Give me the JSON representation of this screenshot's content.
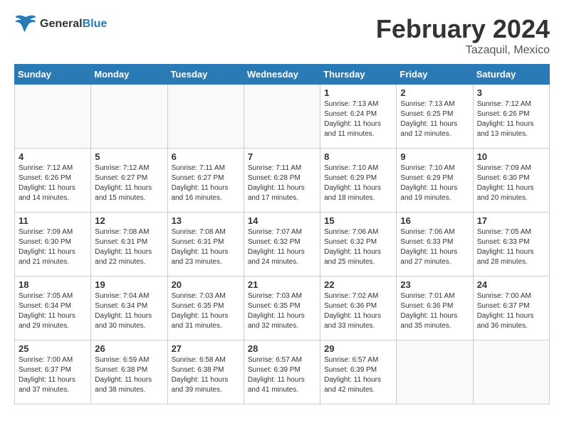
{
  "header": {
    "logo_line1": "General",
    "logo_line2": "Blue",
    "month_title": "February 2024",
    "location": "Tazaquil, Mexico"
  },
  "weekdays": [
    "Sunday",
    "Monday",
    "Tuesday",
    "Wednesday",
    "Thursday",
    "Friday",
    "Saturday"
  ],
  "weeks": [
    [
      {
        "day": "",
        "info": ""
      },
      {
        "day": "",
        "info": ""
      },
      {
        "day": "",
        "info": ""
      },
      {
        "day": "",
        "info": ""
      },
      {
        "day": "1",
        "info": "Sunrise: 7:13 AM\nSunset: 6:24 PM\nDaylight: 11 hours\nand 11 minutes."
      },
      {
        "day": "2",
        "info": "Sunrise: 7:13 AM\nSunset: 6:25 PM\nDaylight: 11 hours\nand 12 minutes."
      },
      {
        "day": "3",
        "info": "Sunrise: 7:12 AM\nSunset: 6:26 PM\nDaylight: 11 hours\nand 13 minutes."
      }
    ],
    [
      {
        "day": "4",
        "info": "Sunrise: 7:12 AM\nSunset: 6:26 PM\nDaylight: 11 hours\nand 14 minutes."
      },
      {
        "day": "5",
        "info": "Sunrise: 7:12 AM\nSunset: 6:27 PM\nDaylight: 11 hours\nand 15 minutes."
      },
      {
        "day": "6",
        "info": "Sunrise: 7:11 AM\nSunset: 6:27 PM\nDaylight: 11 hours\nand 16 minutes."
      },
      {
        "day": "7",
        "info": "Sunrise: 7:11 AM\nSunset: 6:28 PM\nDaylight: 11 hours\nand 17 minutes."
      },
      {
        "day": "8",
        "info": "Sunrise: 7:10 AM\nSunset: 6:29 PM\nDaylight: 11 hours\nand 18 minutes."
      },
      {
        "day": "9",
        "info": "Sunrise: 7:10 AM\nSunset: 6:29 PM\nDaylight: 11 hours\nand 19 minutes."
      },
      {
        "day": "10",
        "info": "Sunrise: 7:09 AM\nSunset: 6:30 PM\nDaylight: 11 hours\nand 20 minutes."
      }
    ],
    [
      {
        "day": "11",
        "info": "Sunrise: 7:09 AM\nSunset: 6:30 PM\nDaylight: 11 hours\nand 21 minutes."
      },
      {
        "day": "12",
        "info": "Sunrise: 7:08 AM\nSunset: 6:31 PM\nDaylight: 11 hours\nand 22 minutes."
      },
      {
        "day": "13",
        "info": "Sunrise: 7:08 AM\nSunset: 6:31 PM\nDaylight: 11 hours\nand 23 minutes."
      },
      {
        "day": "14",
        "info": "Sunrise: 7:07 AM\nSunset: 6:32 PM\nDaylight: 11 hours\nand 24 minutes."
      },
      {
        "day": "15",
        "info": "Sunrise: 7:06 AM\nSunset: 6:32 PM\nDaylight: 11 hours\nand 25 minutes."
      },
      {
        "day": "16",
        "info": "Sunrise: 7:06 AM\nSunset: 6:33 PM\nDaylight: 11 hours\nand 27 minutes."
      },
      {
        "day": "17",
        "info": "Sunrise: 7:05 AM\nSunset: 6:33 PM\nDaylight: 11 hours\nand 28 minutes."
      }
    ],
    [
      {
        "day": "18",
        "info": "Sunrise: 7:05 AM\nSunset: 6:34 PM\nDaylight: 11 hours\nand 29 minutes."
      },
      {
        "day": "19",
        "info": "Sunrise: 7:04 AM\nSunset: 6:34 PM\nDaylight: 11 hours\nand 30 minutes."
      },
      {
        "day": "20",
        "info": "Sunrise: 7:03 AM\nSunset: 6:35 PM\nDaylight: 11 hours\nand 31 minutes."
      },
      {
        "day": "21",
        "info": "Sunrise: 7:03 AM\nSunset: 6:35 PM\nDaylight: 11 hours\nand 32 minutes."
      },
      {
        "day": "22",
        "info": "Sunrise: 7:02 AM\nSunset: 6:36 PM\nDaylight: 11 hours\nand 33 minutes."
      },
      {
        "day": "23",
        "info": "Sunrise: 7:01 AM\nSunset: 6:36 PM\nDaylight: 11 hours\nand 35 minutes."
      },
      {
        "day": "24",
        "info": "Sunrise: 7:00 AM\nSunset: 6:37 PM\nDaylight: 11 hours\nand 36 minutes."
      }
    ],
    [
      {
        "day": "25",
        "info": "Sunrise: 7:00 AM\nSunset: 6:37 PM\nDaylight: 11 hours\nand 37 minutes."
      },
      {
        "day": "26",
        "info": "Sunrise: 6:59 AM\nSunset: 6:38 PM\nDaylight: 11 hours\nand 38 minutes."
      },
      {
        "day": "27",
        "info": "Sunrise: 6:58 AM\nSunset: 6:38 PM\nDaylight: 11 hours\nand 39 minutes."
      },
      {
        "day": "28",
        "info": "Sunrise: 6:57 AM\nSunset: 6:39 PM\nDaylight: 11 hours\nand 41 minutes."
      },
      {
        "day": "29",
        "info": "Sunrise: 6:57 AM\nSunset: 6:39 PM\nDaylight: 11 hours\nand 42 minutes."
      },
      {
        "day": "",
        "info": ""
      },
      {
        "day": "",
        "info": ""
      }
    ]
  ]
}
